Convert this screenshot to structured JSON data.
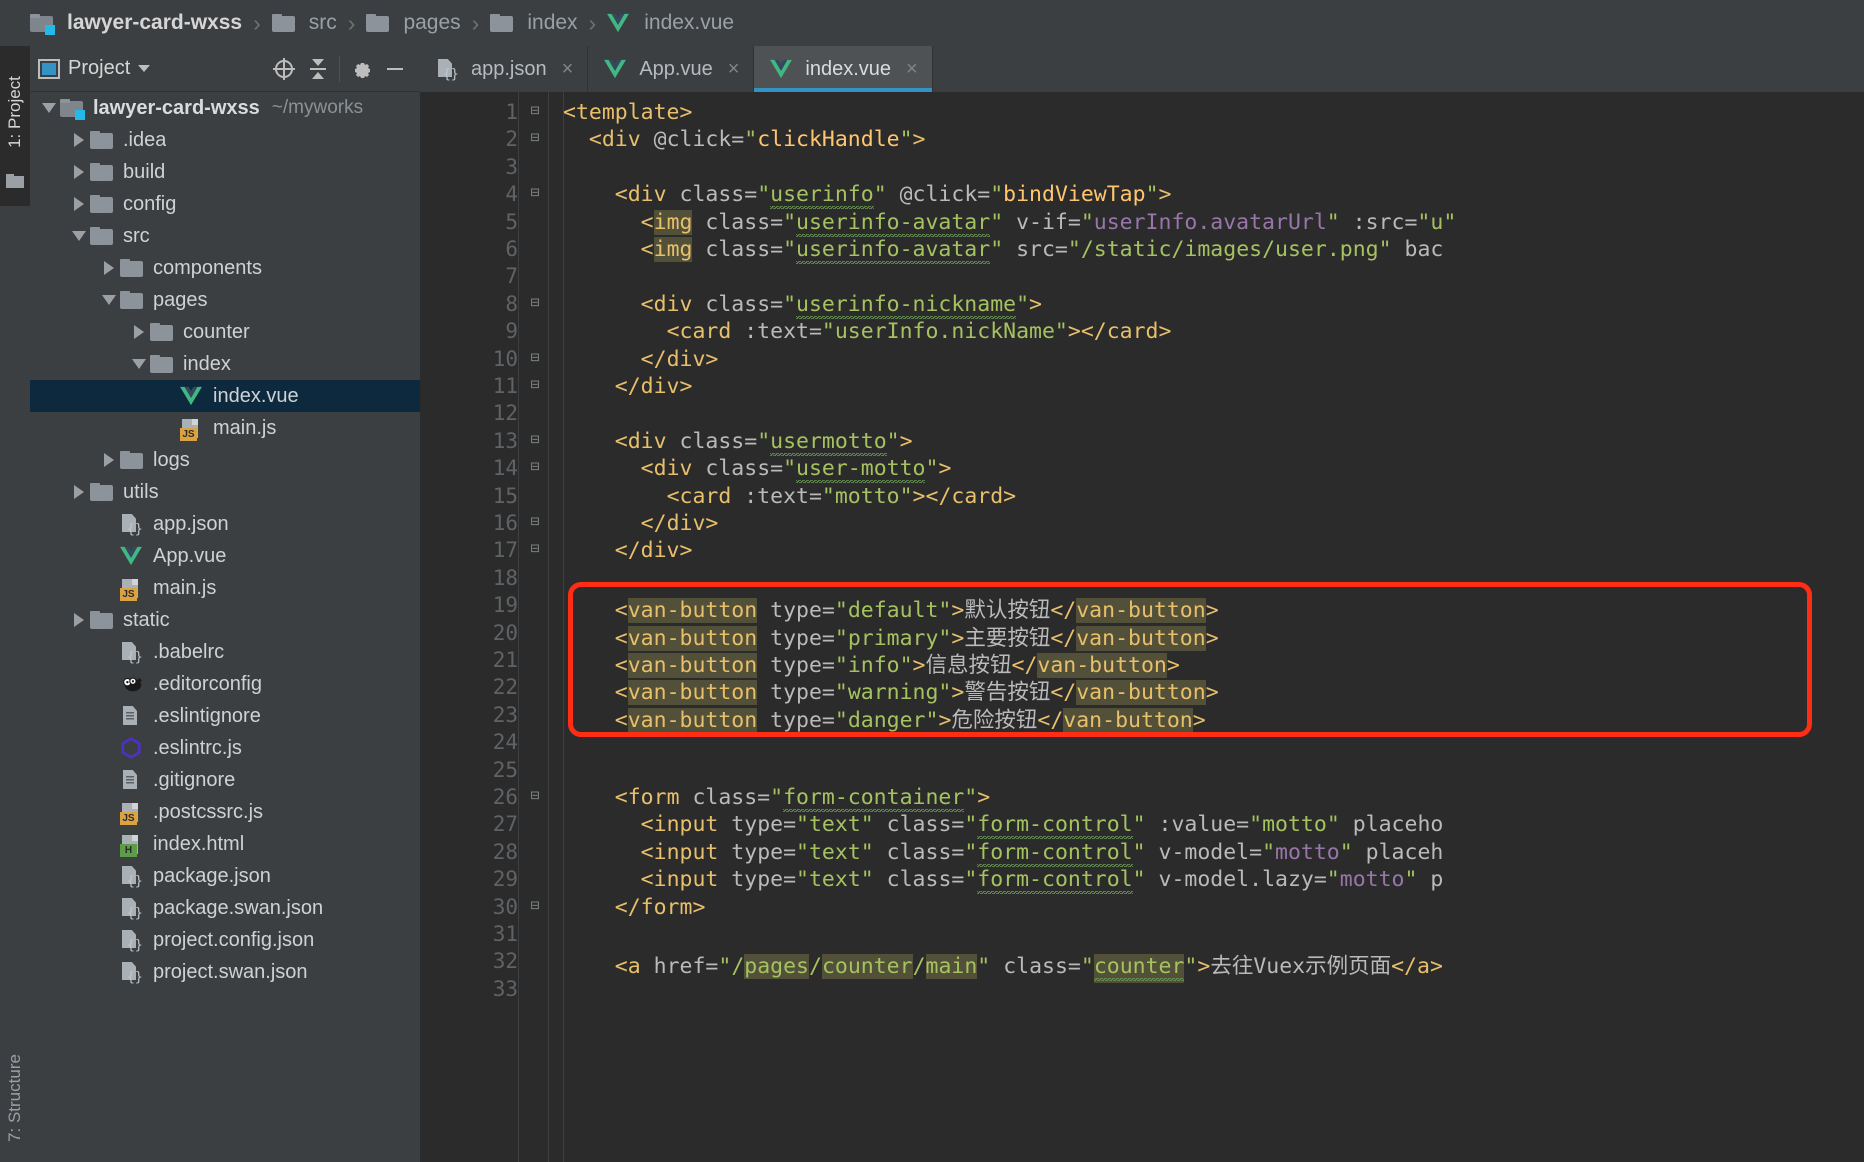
{
  "breadcrumb": {
    "items": [
      {
        "label": "lawyer-card-wxss",
        "icon": "folder-module-icon"
      },
      {
        "label": "src",
        "icon": "folder-icon"
      },
      {
        "label": "pages",
        "icon": "folder-icon"
      },
      {
        "label": "index",
        "icon": "folder-icon"
      },
      {
        "label": "index.vue",
        "icon": "vue-file-icon"
      }
    ],
    "separator": "›"
  },
  "tool_strips": {
    "left_top": "1: Project",
    "left_bottom": "7: Structure"
  },
  "project_panel": {
    "title": "Project",
    "caret": "▾",
    "toolbar": [
      {
        "name": "locate-icon",
        "glyph": "⊕"
      },
      {
        "name": "collapse-all-icon",
        "glyph": "⤓"
      },
      {
        "name": "settings-gear-icon",
        "glyph": "⚙"
      },
      {
        "name": "hide-panel-icon",
        "glyph": "—"
      }
    ],
    "tree": [
      {
        "label": "lawyer-card-wxss",
        "path": "~/myworks",
        "indent": 0,
        "twist": "down",
        "icon": "folder-module-icon",
        "bold": true,
        "selected": false
      },
      {
        "label": ".idea",
        "path": "",
        "indent": 1,
        "twist": "right",
        "icon": "folder-icon",
        "bold": false,
        "selected": false
      },
      {
        "label": "build",
        "path": "",
        "indent": 1,
        "twist": "right",
        "icon": "folder-icon",
        "bold": false,
        "selected": false
      },
      {
        "label": "config",
        "path": "",
        "indent": 1,
        "twist": "right",
        "icon": "folder-icon",
        "bold": false,
        "selected": false
      },
      {
        "label": "src",
        "path": "",
        "indent": 1,
        "twist": "down",
        "icon": "folder-icon",
        "bold": false,
        "selected": false
      },
      {
        "label": "components",
        "path": "",
        "indent": 2,
        "twist": "right",
        "icon": "folder-icon",
        "bold": false,
        "selected": false
      },
      {
        "label": "pages",
        "path": "",
        "indent": 2,
        "twist": "down",
        "icon": "folder-icon",
        "bold": false,
        "selected": false
      },
      {
        "label": "counter",
        "path": "",
        "indent": 3,
        "twist": "right",
        "icon": "folder-icon",
        "bold": false,
        "selected": false
      },
      {
        "label": "index",
        "path": "",
        "indent": 3,
        "twist": "down",
        "icon": "folder-icon",
        "bold": false,
        "selected": false
      },
      {
        "label": "index.vue",
        "path": "",
        "indent": 4,
        "twist": "none",
        "icon": "vue-file-icon",
        "bold": false,
        "selected": true
      },
      {
        "label": "main.js",
        "path": "",
        "indent": 4,
        "twist": "none",
        "icon": "js-file-icon",
        "bold": false,
        "selected": false
      },
      {
        "label": "logs",
        "path": "",
        "indent": 2,
        "twist": "right",
        "icon": "folder-icon",
        "bold": false,
        "selected": false
      },
      {
        "label": "utils",
        "path": "",
        "indent": 1,
        "twist": "right",
        "icon": "folder-icon",
        "bold": false,
        "selected": false
      },
      {
        "label": "app.json",
        "path": "",
        "indent": 2,
        "twist": "none",
        "icon": "json-file-icon",
        "bold": false,
        "selected": false
      },
      {
        "label": "App.vue",
        "path": "",
        "indent": 2,
        "twist": "none",
        "icon": "vue-file-icon",
        "bold": false,
        "selected": false
      },
      {
        "label": "main.js",
        "path": "",
        "indent": 2,
        "twist": "none",
        "icon": "js-file-icon",
        "bold": false,
        "selected": false
      },
      {
        "label": "static",
        "path": "",
        "indent": 1,
        "twist": "right",
        "icon": "folder-icon",
        "bold": false,
        "selected": false
      },
      {
        "label": ".babelrc",
        "path": "",
        "indent": 2,
        "twist": "none",
        "icon": "json-file-icon",
        "bold": false,
        "selected": false
      },
      {
        "label": ".editorconfig",
        "path": "",
        "indent": 2,
        "twist": "none",
        "icon": "editorconfig-icon",
        "bold": false,
        "selected": false
      },
      {
        "label": ".eslintignore",
        "path": "",
        "indent": 2,
        "twist": "none",
        "icon": "text-file-icon",
        "bold": false,
        "selected": false
      },
      {
        "label": ".eslintrc.js",
        "path": "",
        "indent": 2,
        "twist": "none",
        "icon": "eslint-icon",
        "bold": false,
        "selected": false
      },
      {
        "label": ".gitignore",
        "path": "",
        "indent": 2,
        "twist": "none",
        "icon": "text-file-icon",
        "bold": false,
        "selected": false
      },
      {
        "label": ".postcssrc.js",
        "path": "",
        "indent": 2,
        "twist": "none",
        "icon": "js-file-icon",
        "bold": false,
        "selected": false
      },
      {
        "label": "index.html",
        "path": "",
        "indent": 2,
        "twist": "none",
        "icon": "html-file-icon",
        "bold": false,
        "selected": false
      },
      {
        "label": "package.json",
        "path": "",
        "indent": 2,
        "twist": "none",
        "icon": "json-file-icon",
        "bold": false,
        "selected": false
      },
      {
        "label": "package.swan.json",
        "path": "",
        "indent": 2,
        "twist": "none",
        "icon": "json-file-icon",
        "bold": false,
        "selected": false
      },
      {
        "label": "project.config.json",
        "path": "",
        "indent": 2,
        "twist": "none",
        "icon": "json-file-icon",
        "bold": false,
        "selected": false
      },
      {
        "label": "project.swan.json",
        "path": "",
        "indent": 2,
        "twist": "none",
        "icon": "json-file-icon",
        "bold": false,
        "selected": false
      }
    ]
  },
  "editor": {
    "tabs": [
      {
        "label": "app.json",
        "icon": "json-file-icon",
        "active": false,
        "close": "×"
      },
      {
        "label": "App.vue",
        "icon": "vue-file-icon",
        "active": false,
        "close": "×"
      },
      {
        "label": "index.vue",
        "icon": "vue-file-icon",
        "active": true,
        "close": "×"
      }
    ],
    "accent_color": "#3592c4",
    "highlight_box_color": "#ff2d14",
    "first_line": 1,
    "last_line": 33,
    "lines": [
      {
        "n": 1,
        "fold": "⊟",
        "text": "<template>"
      },
      {
        "n": 2,
        "fold": "⊟",
        "text": "  <div @click=\"clickHandle\">"
      },
      {
        "n": 3,
        "fold": "",
        "text": ""
      },
      {
        "n": 4,
        "fold": "⊟",
        "text": "    <div class=\"userinfo\" @click=\"bindViewTap\">"
      },
      {
        "n": 5,
        "fold": "",
        "text": "      <img class=\"userinfo-avatar\" v-if=\"userInfo.avatarUrl\" :src=\"u"
      },
      {
        "n": 6,
        "fold": "",
        "text": "      <img class=\"userinfo-avatar\" src=\"/static/images/user.png\" bac"
      },
      {
        "n": 7,
        "fold": "",
        "text": ""
      },
      {
        "n": 8,
        "fold": "⊟",
        "text": "      <div class=\"userinfo-nickname\">"
      },
      {
        "n": 9,
        "fold": "",
        "text": "        <card :text=\"userInfo.nickName\"></card>"
      },
      {
        "n": 10,
        "fold": "⊟",
        "text": "      </div>"
      },
      {
        "n": 11,
        "fold": "⊟",
        "text": "    </div>"
      },
      {
        "n": 12,
        "fold": "",
        "text": ""
      },
      {
        "n": 13,
        "fold": "⊟",
        "text": "    <div class=\"usermotto\">"
      },
      {
        "n": 14,
        "fold": "⊟",
        "text": "      <div class=\"user-motto\">"
      },
      {
        "n": 15,
        "fold": "",
        "text": "        <card :text=\"motto\"></card>"
      },
      {
        "n": 16,
        "fold": "⊟",
        "text": "      </div>"
      },
      {
        "n": 17,
        "fold": "⊟",
        "text": "    </div>"
      },
      {
        "n": 18,
        "fold": "",
        "text": ""
      },
      {
        "n": 19,
        "fold": "",
        "text": "    <van-button type=\"default\">默认按钮</van-button>"
      },
      {
        "n": 20,
        "fold": "",
        "text": "    <van-button type=\"primary\">主要按钮</van-button>"
      },
      {
        "n": 21,
        "fold": "",
        "text": "    <van-button type=\"info\">信息按钮</van-button>"
      },
      {
        "n": 22,
        "fold": "",
        "text": "    <van-button type=\"warning\">警告按钮</van-button>"
      },
      {
        "n": 23,
        "fold": "",
        "text": "    <van-button type=\"danger\">危险按钮</van-button>"
      },
      {
        "n": 24,
        "fold": "",
        "text": ""
      },
      {
        "n": 25,
        "fold": "",
        "text": ""
      },
      {
        "n": 26,
        "fold": "⊟",
        "text": "    <form class=\"form-container\">"
      },
      {
        "n": 27,
        "fold": "",
        "text": "      <input type=\"text\" class=\"form-control\" :value=\"motto\" placeho"
      },
      {
        "n": 28,
        "fold": "",
        "text": "      <input type=\"text\" class=\"form-control\" v-model=\"motto\" placeh"
      },
      {
        "n": 29,
        "fold": "",
        "text": "      <input type=\"text\" class=\"form-control\" v-model.lazy=\"motto\" p"
      },
      {
        "n": 30,
        "fold": "⊟",
        "text": "    </form>"
      },
      {
        "n": 31,
        "fold": "",
        "text": ""
      },
      {
        "n": 32,
        "fold": "",
        "text": "    <a href=\"/pages/counter/main\" class=\"counter\">去往Vuex示例页面</a>"
      },
      {
        "n": 33,
        "fold": "",
        "text": ""
      }
    ]
  }
}
